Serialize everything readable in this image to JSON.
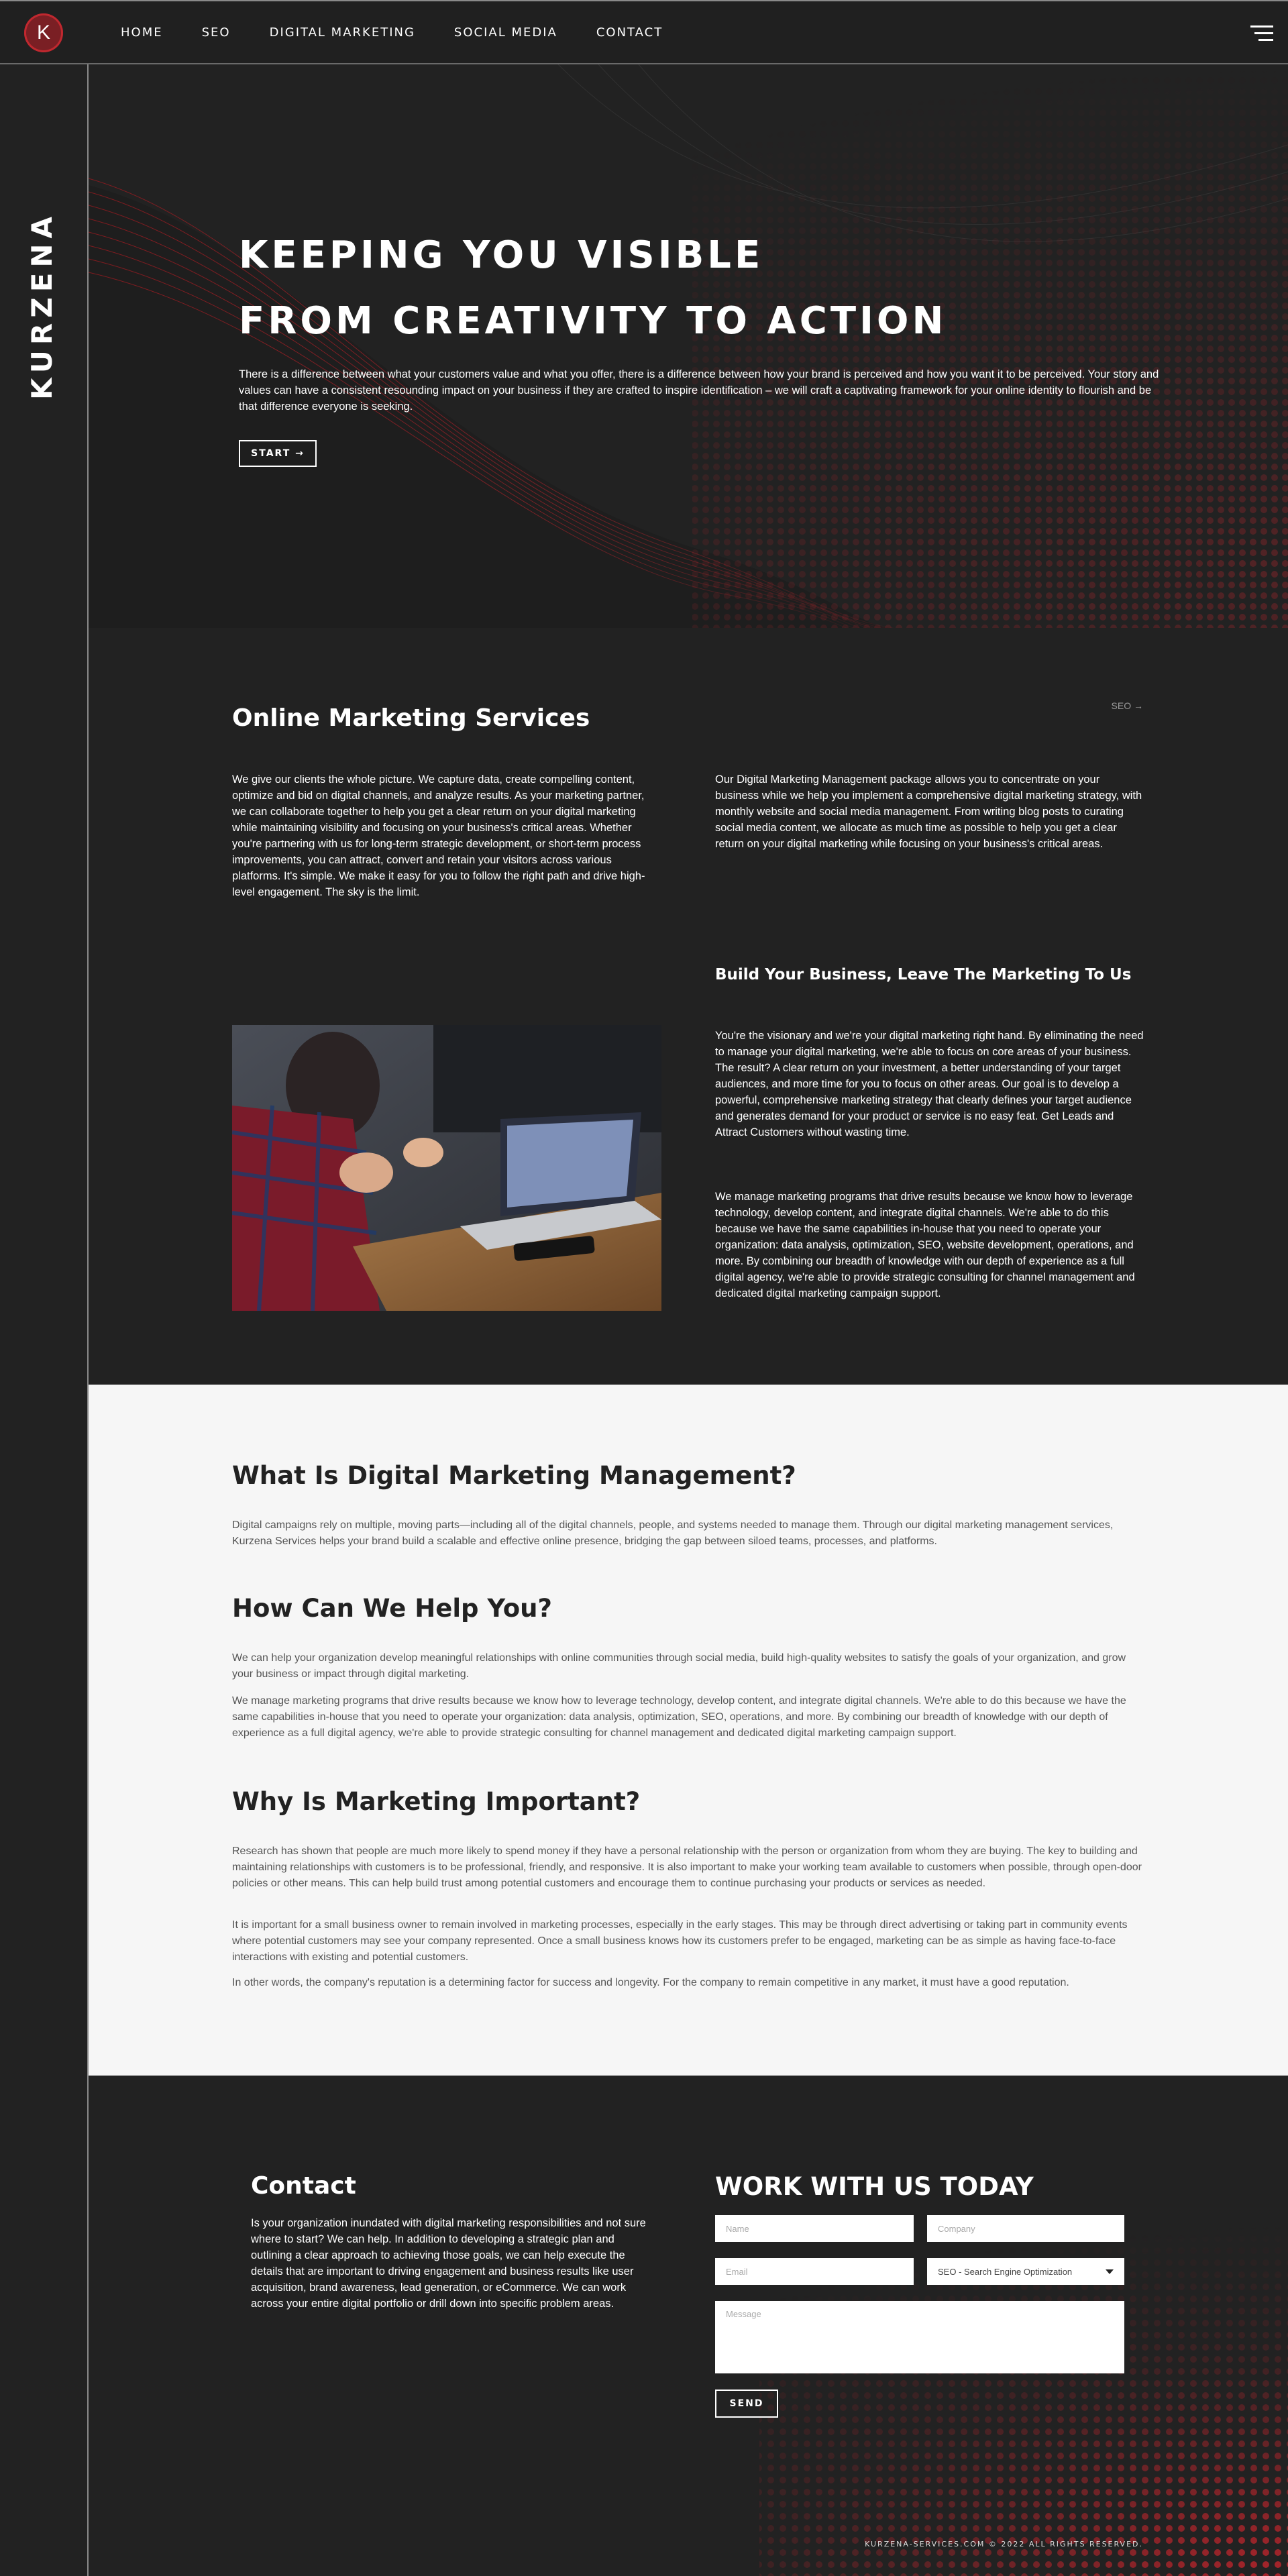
{
  "header": {
    "logo_letter": "K",
    "nav": [
      "HOME",
      "SEO",
      "DIGITAL MARKETING",
      "SOCIAL MEDIA",
      "CONTACT"
    ],
    "menu_icon": "hamburger-menu-icon"
  },
  "sidebar": {
    "brand": "KURZENA"
  },
  "hero": {
    "title_line1": "KEEPING YOU VISIBLE",
    "title_line2": "FROM CREATIVITY TO ACTION",
    "text": "There is a difference between what your customers value and what you offer, there is a difference between how your brand is perceived and how you want it to be perceived. Your story and values can have a consistent resounding impact on your business if they are crafted to inspire identification – we will craft a captivating framework for your online identity to flourish and be that difference everyone is seeking.",
    "button": "START →"
  },
  "services": {
    "title": "Online Marketing Services",
    "tag": "SEO →",
    "col_left": "We give our clients the whole picture. We capture data, create compelling content, optimize and bid on digital channels, and analyze results. As your marketing partner, we can collaborate together to help you get a clear return on your digital marketing while maintaining visibility and focusing on your business's critical areas. Whether you're partnering with us for long-term strategic development, or short-term process improvements, you can attract, convert and retain your visitors across various platforms. It's simple. We make it easy for you to follow the right path and drive high-level engagement. The sky is the limit.",
    "col_right": "Our Digital Marketing Management package allows you to concentrate on your business while we help you implement a comprehensive digital marketing strategy, with monthly website and social media management. From writing blog posts to curating social media content, we allocate as much time as possible to help you get a clear return on your digital marketing while focusing on your business's critical areas.",
    "subtitle": "Build Your Business, Leave The Marketing To Us",
    "para1": "You're the visionary and we're your digital marketing right hand. By eliminating the need to manage your digital marketing, we're able to focus on core areas of your business. The result? A clear return on your investment, a better understanding of your target audiences, and more time for you to focus on other areas. Our goal is to develop a powerful, comprehensive marketing strategy that clearly defines your target audience and generates demand for your product or service is no easy feat. Get Leads and Attract Customers without wasting time.",
    "para2": "We manage marketing programs that drive results because we know how to leverage technology, develop content, and integrate digital channels. We're able to do this because we have the same capabilities in-house that you need to operate your organization: data analysis, optimization, SEO, website development, operations, and more. By combining our breadth of knowledge with our depth of experience as a full digital agency, we're able to provide strategic consulting for channel management and dedicated digital marketing campaign support."
  },
  "info": {
    "h1": "What Is Digital Marketing Management?",
    "p1": "Digital campaigns rely on multiple, moving parts—including all of the digital channels, people, and systems needed to manage them. Through our digital marketing management services, Kurzena Services helps your brand build a scalable and effective online presence, bridging the gap between siloed teams, processes, and platforms.",
    "h2": "How Can We Help You?",
    "p2": "We can help your organization develop meaningful relationships with online communities through social media, build high-quality websites to satisfy the goals of your organization, and grow your business or impact through digital marketing.",
    "p3": "We manage marketing programs that drive results because we know how to leverage technology, develop content, and integrate digital channels. We're able to do this because we have the same capabilities in-house that you need to operate your organization: data analysis, optimization, SEO, operations, and more. By combining our breadth of knowledge with our depth of experience as a full digital agency, we're able to provide strategic consulting for channel management and dedicated digital marketing campaign support.",
    "h3": "Why Is Marketing Important?",
    "p4": "Research has shown that people are much more likely to spend money if they have a personal relationship with the person or organization from whom they are buying. The key to building and maintaining relationships with customers is to be professional, friendly, and responsive. It is also important to make your working team available to customers when possible, through open-door policies or other means. This can help build trust among potential customers and encourage them to continue purchasing your products or services as needed.",
    "p5": "It is important for a small business owner to remain involved in marketing processes, especially in the early stages. This may be through direct advertising or taking part in community events where potential customers may see your company represented. Once a small business knows how its customers prefer to be engaged, marketing can be as simple as having face-to-face interactions with existing and potential customers.",
    "p6": "In other words, the company's reputation is a determining factor for success and longevity. For the company to remain competitive in any market, it must have a good reputation."
  },
  "contact": {
    "title": "Contact",
    "text": "Is your organization inundated with digital marketing responsibilities and not sure where to start? We can help. In addition to developing a strategic plan and outlining a clear approach to achieving those goals, we can help execute the details that are important to driving engagement and business results like user acquisition, brand awareness, lead generation, or eCommerce. We can work across your entire digital portfolio or drill down into specific problem areas.",
    "form_title": "WORK WITH US TODAY",
    "name_placeholder": "Name",
    "company_placeholder": "Company",
    "email_placeholder": "Email",
    "select_value": "SEO - Search Engine Optimization",
    "message_placeholder": "Message",
    "send": "SEND",
    "copyright": "KURZENA-SERVICES.COM © 2022 ALL RIGHTS RESERVED."
  },
  "colors": {
    "background": "#222222",
    "accent": "#c0282f",
    "light": "#f6f6f6"
  }
}
